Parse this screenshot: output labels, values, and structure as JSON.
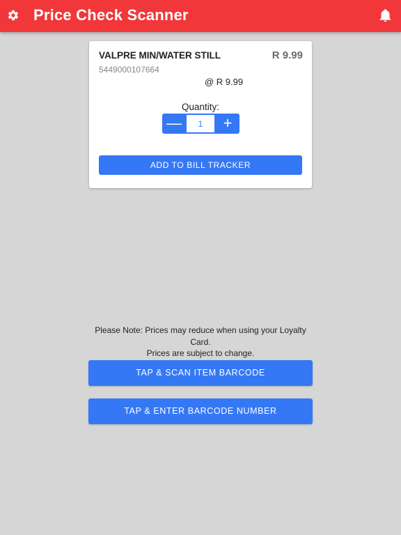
{
  "header": {
    "title": "Price Check Scanner",
    "settings_icon": "gear-icon",
    "notifications_icon": "bell-icon",
    "color": "#f1373a"
  },
  "item": {
    "name": "VALPRE MIN/WATER STILL",
    "price": "R 9.99",
    "barcode": "5449000107664",
    "unit_price": "@ R 9.99",
    "quantity_label": "Quantity:",
    "quantity": "1",
    "minus_label": "—",
    "plus_label": "+",
    "add_button_label": "ADD TO BILL TRACKER"
  },
  "note": {
    "line1": "Please Note: Prices may reduce when using your Loyalty Card.",
    "line2": "Prices are subject to change."
  },
  "actions": {
    "scan_label": "TAP & SCAN ITEM BARCODE",
    "enter_label": "TAP & ENTER BARCODE NUMBER"
  },
  "colors": {
    "accent": "#3578f6",
    "background": "#d6d6d6"
  }
}
